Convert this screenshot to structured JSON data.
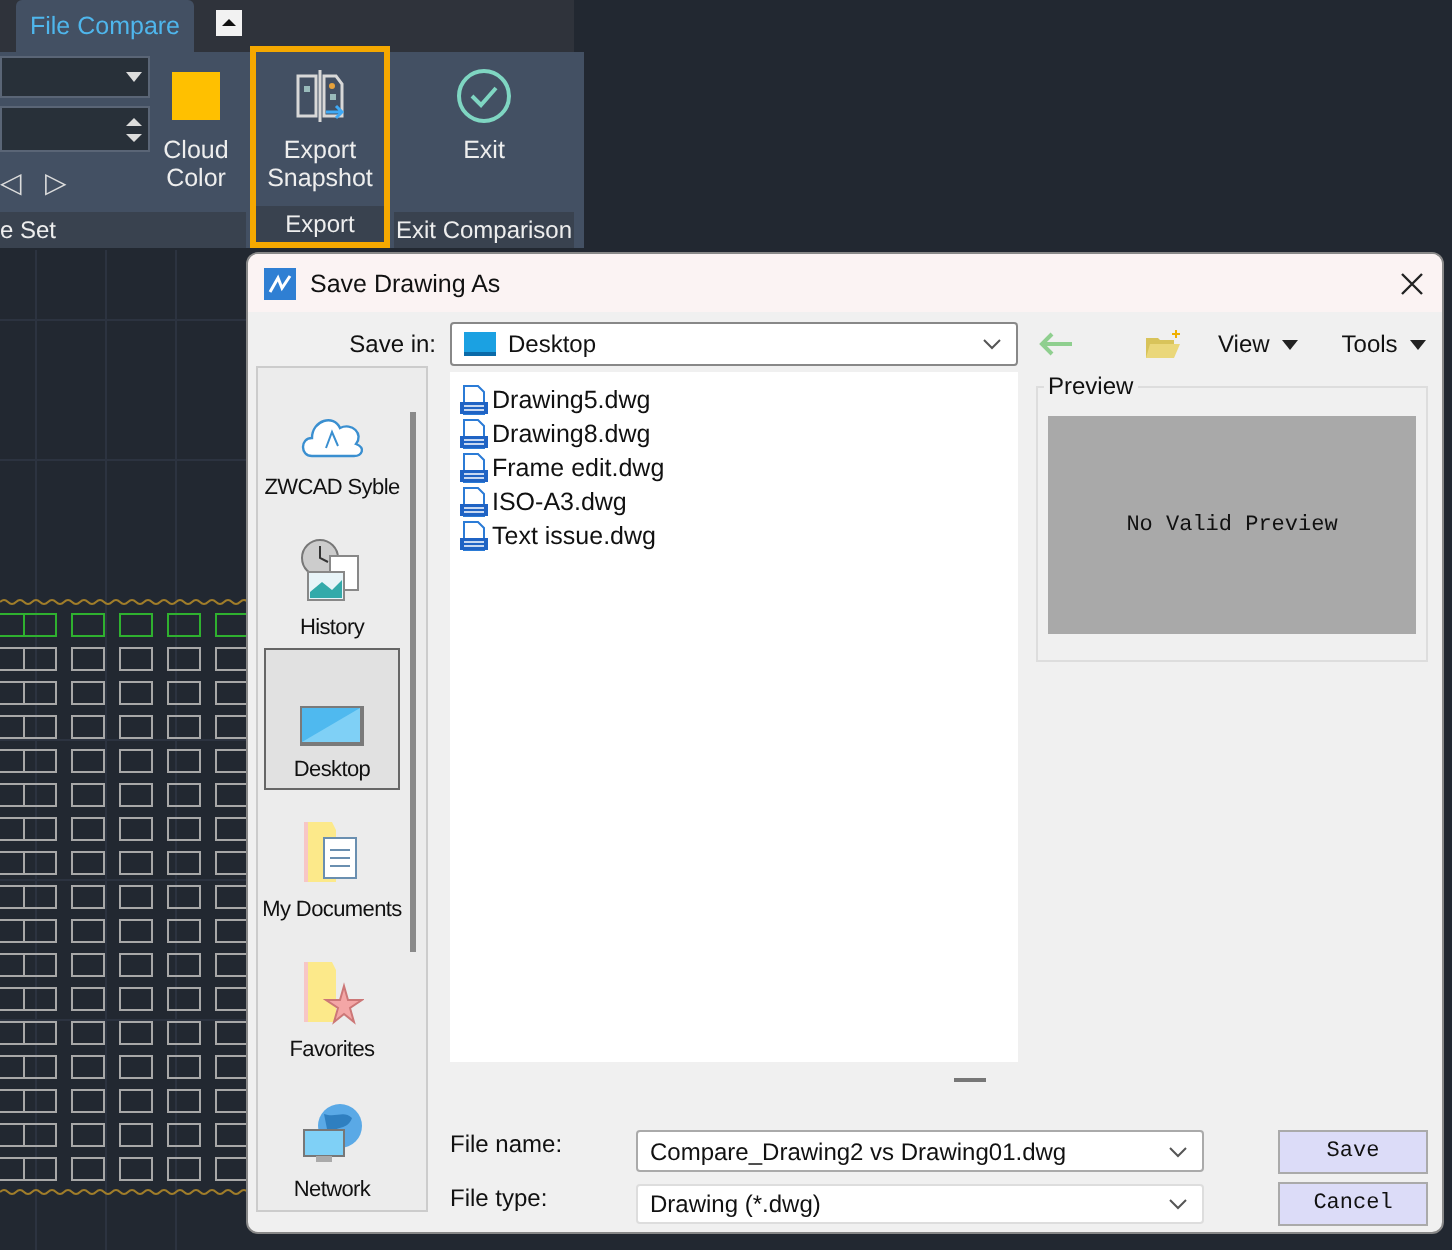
{
  "ribbon": {
    "tabs": [
      {
        "label": "File Compare",
        "selected": true
      }
    ],
    "left_group": {
      "prev": "◁",
      "next": "▷",
      "footer": "e Set"
    },
    "buttons": [
      {
        "label": "Cloud Color",
        "kind": "swatch",
        "highlighted": false
      },
      {
        "label": "Export Snapshot",
        "kind": "snapshot",
        "highlighted": true,
        "group": "Export"
      },
      {
        "label": "Exit",
        "kind": "exit",
        "highlighted": false,
        "group": "Exit Comparison"
      }
    ]
  },
  "dialog": {
    "title": "Save Drawing As",
    "save_in_label": "Save in:",
    "save_in": "Desktop",
    "view": "View",
    "tools": "Tools",
    "places": [
      {
        "label": "ZWCAD Syble",
        "kind": "cloud",
        "selected": false
      },
      {
        "label": "History",
        "kind": "history",
        "selected": false
      },
      {
        "label": "Desktop",
        "kind": "desktop",
        "selected": true
      },
      {
        "label": "My Documents",
        "kind": "documents",
        "selected": false
      },
      {
        "label": "Favorites",
        "kind": "favorites",
        "selected": false
      },
      {
        "label": "Network",
        "kind": "network",
        "selected": false
      }
    ],
    "files": [
      "Drawing5.dwg",
      "Drawing8.dwg",
      "Frame edit.dwg",
      "ISO-A3.dwg",
      "Text issue.dwg"
    ],
    "preview": {
      "title": "Preview",
      "message": "No Valid Preview"
    },
    "file_name": {
      "label": "File name:",
      "value": "Compare_Drawing2 vs Drawing01.dwg"
    },
    "file_type": {
      "label": "File type:",
      "value": "Drawing (*.dwg)"
    },
    "buttons": [
      "Save",
      "Cancel"
    ]
  }
}
